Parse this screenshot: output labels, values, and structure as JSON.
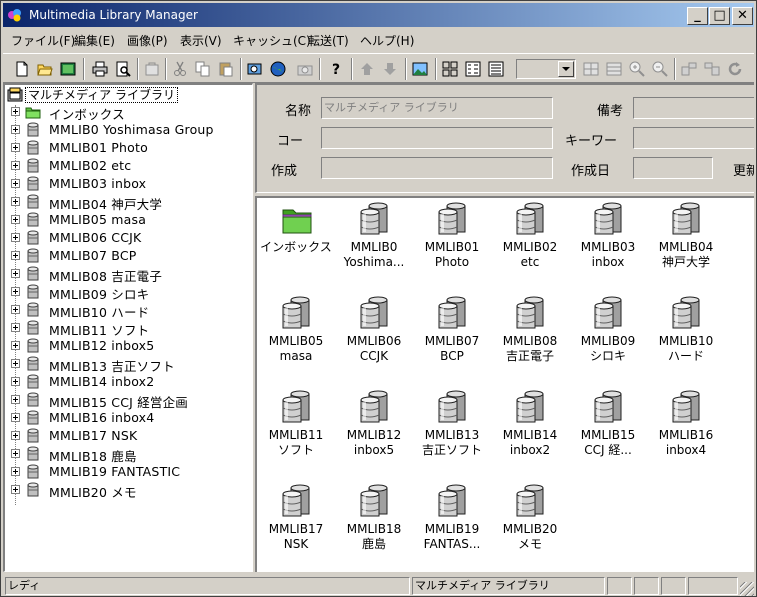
{
  "window": {
    "title": "Multimedia Library Manager",
    "minimize": "_",
    "maximize": "□",
    "close": "✕"
  },
  "menu": [
    "ファイル(F)",
    "編集(E)",
    "画像(P)",
    "表示(V)",
    "キャッシュ(C)",
    "転送(T)",
    "ヘルプ(H)"
  ],
  "tree": {
    "root": "マルチメディア ライブラリ",
    "items": [
      "インボックス",
      "MMLIB0 Yoshimasa Group",
      "MMLIB01  Photo",
      "MMLIB02  etc",
      "MMLIB03  inbox",
      "MMLIB04  神戸大学",
      "MMLIB05  masa",
      "MMLIB06  CCJK",
      "MMLIB07  BCP",
      "MMLIB08  吉正電子",
      "MMLIB09  シロキ",
      "MMLIB10  ハード",
      "MMLIB11  ソフト",
      "MMLIB12  inbox5",
      "MMLIB13   吉正ソフト",
      "MMLIB14  inbox2",
      "MMLIB15  CCJ 経営企画",
      "MMLIB16  inbox4",
      "MMLIB17  NSK",
      "MMLIB18  鹿島",
      "MMLIB19   FANTASTIC",
      "MMLIB20  メモ"
    ]
  },
  "properties": {
    "name_label": "名称",
    "name_value": "マルチメディア ライブラリ",
    "note_label": "備考",
    "code_label": "コー",
    "keyword_label": "キーワー",
    "created_label": "作成",
    "created_date_label": "作成日",
    "updated_label": "更新"
  },
  "icons": [
    {
      "line1": "インボックス",
      "line2": "",
      "type": "folder"
    },
    {
      "line1": "MMLIB0",
      "line2": "Yoshima...",
      "type": "db"
    },
    {
      "line1": "MMLIB01",
      "line2": "Photo",
      "type": "db"
    },
    {
      "line1": "MMLIB02",
      "line2": "etc",
      "type": "db"
    },
    {
      "line1": "MMLIB03",
      "line2": "inbox",
      "type": "db"
    },
    {
      "line1": "MMLIB04",
      "line2": "神戸大学",
      "type": "db"
    },
    {
      "line1": "MMLIB05",
      "line2": "masa",
      "type": "db"
    },
    {
      "line1": "MMLIB06",
      "line2": "CCJK",
      "type": "db"
    },
    {
      "line1": "MMLIB07",
      "line2": "BCP",
      "type": "db"
    },
    {
      "line1": "MMLIB08",
      "line2": "吉正電子",
      "type": "db"
    },
    {
      "line1": "MMLIB09",
      "line2": "シロキ",
      "type": "db"
    },
    {
      "line1": "MMLIB10",
      "line2": "ハード",
      "type": "db"
    },
    {
      "line1": "MMLIB11",
      "line2": "ソフト",
      "type": "db"
    },
    {
      "line1": "MMLIB12",
      "line2": "inbox5",
      "type": "db"
    },
    {
      "line1": "MMLIB13",
      "line2": "吉正ソフト",
      "type": "db"
    },
    {
      "line1": "MMLIB14",
      "line2": "inbox2",
      "type": "db"
    },
    {
      "line1": "MMLIB15",
      "line2": "CCJ 経...",
      "type": "db"
    },
    {
      "line1": "MMLIB16",
      "line2": "inbox4",
      "type": "db"
    },
    {
      "line1": "MMLIB17",
      "line2": "NSK",
      "type": "db"
    },
    {
      "line1": "MMLIB18",
      "line2": "鹿島",
      "type": "db"
    },
    {
      "line1": "MMLIB19",
      "line2": "FANTAS...",
      "type": "db"
    },
    {
      "line1": "MMLIB20",
      "line2": "メモ",
      "type": "db"
    }
  ],
  "status": {
    "left": "レディ",
    "middle": "マルチメディア ライブラリ"
  },
  "colors": {
    "title_start": "#0a246a",
    "title_end": "#a6caf0",
    "face": "#d4d0c8"
  }
}
